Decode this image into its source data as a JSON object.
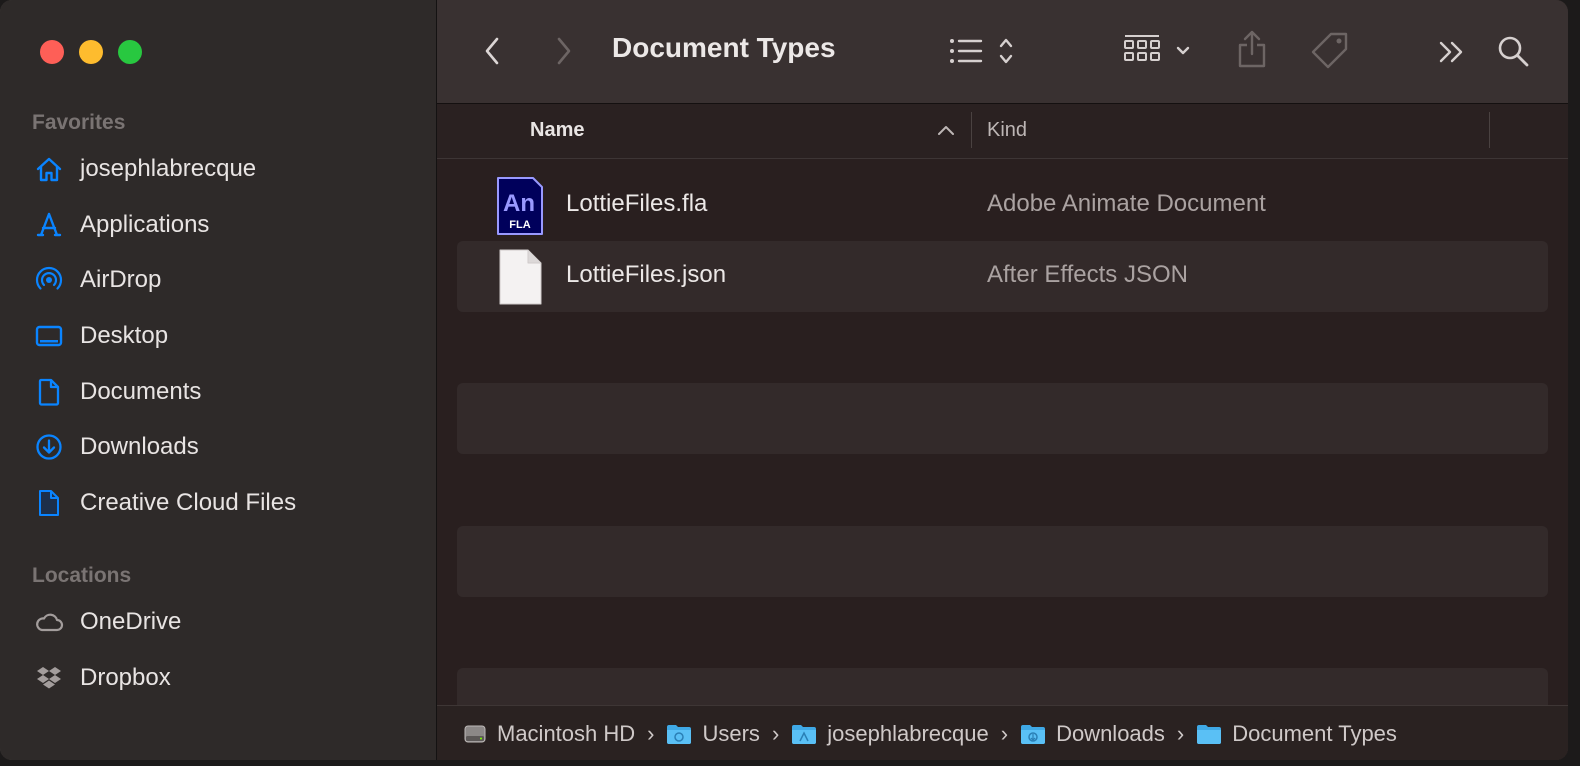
{
  "window": {
    "title": "Document Types"
  },
  "sidebar": {
    "favorites_header": "Favorites",
    "favorites": [
      {
        "label": "josephlabrecque",
        "icon": "home-icon"
      },
      {
        "label": "Applications",
        "icon": "applications-icon"
      },
      {
        "label": "AirDrop",
        "icon": "airdrop-icon"
      },
      {
        "label": "Desktop",
        "icon": "desktop-icon"
      },
      {
        "label": "Documents",
        "icon": "document-icon"
      },
      {
        "label": "Downloads",
        "icon": "download-icon"
      },
      {
        "label": "Creative Cloud Files",
        "icon": "file-icon"
      }
    ],
    "locations_header": "Locations",
    "locations": [
      {
        "label": "OneDrive",
        "icon": "cloud-icon"
      },
      {
        "label": "Dropbox",
        "icon": "dropbox-icon"
      }
    ]
  },
  "columns": {
    "name": "Name",
    "kind": "Kind"
  },
  "files": [
    {
      "name": "LottieFiles.fla",
      "kind": "Adobe Animate Document",
      "icon_text": "An",
      "icon_sub": "FLA"
    },
    {
      "name": "LottieFiles.json",
      "kind": "After Effects JSON"
    }
  ],
  "pathbar": [
    {
      "label": "Macintosh HD",
      "icon": "hard-drive-icon"
    },
    {
      "label": "Users",
      "icon": "folder-icon"
    },
    {
      "label": "josephlabrecque",
      "icon": "folder-icon"
    },
    {
      "label": "Downloads",
      "icon": "folder-icon"
    },
    {
      "label": "Document Types",
      "icon": "folder-icon"
    }
  ],
  "colors": {
    "accent": "#0a84ff",
    "close": "#fe5f57",
    "minimize": "#febc2e",
    "zoom": "#28c840"
  }
}
